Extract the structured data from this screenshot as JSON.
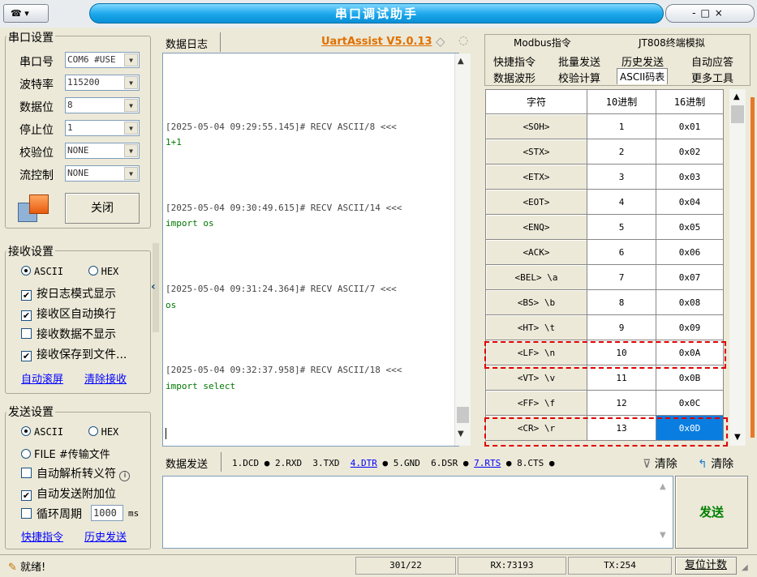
{
  "window": {
    "title": "串口调试助手",
    "menu_glyph": "▾",
    "controls": "-□×"
  },
  "serial": {
    "title": "串口设置",
    "port_label": "串口号",
    "port_value": "COM6 #USE",
    "baud_label": "波特率",
    "baud_value": "115200",
    "data_label": "数据位",
    "data_value": "8",
    "stop_label": "停止位",
    "stop_value": "1",
    "parity_label": "校验位",
    "parity_value": "NONE",
    "flow_label": "流控制",
    "flow_value": "NONE",
    "close_button": "关闭"
  },
  "receive": {
    "title": "接收设置",
    "ascii": "ASCII",
    "hex": "HEX",
    "opt1": "按日志模式显示",
    "opt2": "接收区自动换行",
    "opt3": "接收数据不显示",
    "opt4": "接收保存到文件...",
    "link1": "自动滚屏",
    "link2": "清除接收"
  },
  "send": {
    "title": "发送设置",
    "ascii": "ASCII",
    "hex": "HEX",
    "file": "FILE #传输文件",
    "opt1": "自动解析转义符",
    "opt2": "自动发送附加位",
    "opt3": "循环周期",
    "period": "1000",
    "period_unit": "ms",
    "link1": "快捷指令",
    "link2": "历史发送"
  },
  "log": {
    "tab": "数据日志",
    "brand": "UartAssist V5.0.13",
    "entries": [
      {
        "head": "[2025-05-04 09:29:55.145]# RECV ASCII/8 <<<",
        "body": "1+1"
      },
      {
        "head": "[2025-05-04 09:30:49.615]# RECV ASCII/14 <<<",
        "body": "import os"
      },
      {
        "head": "[2025-05-04 09:31:24.364]# RECV ASCII/7 <<<",
        "body": "os"
      },
      {
        "head": "[2025-05-04 09:32:37.958]# RECV ASCII/18 <<<",
        "body": "import select"
      }
    ]
  },
  "right_tabs": {
    "row1": [
      "Modbus指令",
      "JT808终端模拟"
    ],
    "row2": [
      "快捷指令",
      "批量发送",
      "历史发送",
      "自动应答"
    ],
    "row3": [
      "数据波形",
      "校验计算",
      "ASCII码表",
      "更多工具"
    ]
  },
  "ascii_table": {
    "headers": [
      "字符",
      "10进制",
      "16进制"
    ],
    "rows": [
      [
        "<SOH>",
        "1",
        "0x01"
      ],
      [
        "<STX>",
        "2",
        "0x02"
      ],
      [
        "<ETX>",
        "3",
        "0x03"
      ],
      [
        "<EOT>",
        "4",
        "0x04"
      ],
      [
        "<ENQ>",
        "5",
        "0x05"
      ],
      [
        "<ACK>",
        "6",
        "0x06"
      ],
      [
        "<BEL> \\a",
        "7",
        "0x07"
      ],
      [
        "<BS> \\b",
        "8",
        "0x08"
      ],
      [
        "<HT> \\t",
        "9",
        "0x09"
      ],
      [
        "<LF> \\n",
        "10",
        "0x0A"
      ],
      [
        "<VT> \\v",
        "11",
        "0x0B"
      ],
      [
        "<FF> \\f",
        "12",
        "0x0C"
      ],
      [
        "<CR> \\r",
        "13",
        "0x0D"
      ]
    ]
  },
  "send_bar": {
    "tab": "数据发送",
    "pins": [
      "1.DCD",
      "2.RXD",
      "3.TXD",
      "4.DTR",
      "5.GND",
      "6.DSR",
      "7.RTS",
      "8.CTS"
    ],
    "clear1": "清除",
    "clear2": "清除",
    "send_button": "发送"
  },
  "status": {
    "ready": "就绪!",
    "count": "301/22",
    "rx": "RX:73193",
    "tx": "TX:254",
    "reset": "复位计数"
  }
}
